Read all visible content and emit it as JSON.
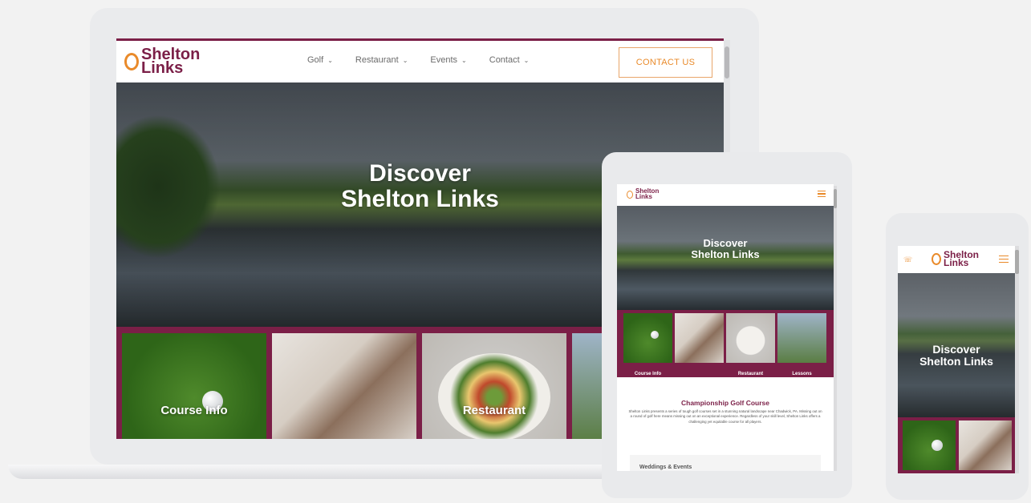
{
  "brand": {
    "logo_line1": "Shelton",
    "logo_line2": "Links",
    "primary_color": "#7b1f47",
    "accent_color": "#e98a2a"
  },
  "desktop": {
    "nav": {
      "items": [
        {
          "label": "Golf",
          "icon": "chevron-down-icon"
        },
        {
          "label": "Restaurant",
          "icon": "chevron-down-icon"
        },
        {
          "label": "Events",
          "icon": "chevron-down-icon"
        },
        {
          "label": "Contact",
          "icon": "chevron-down-icon"
        }
      ],
      "cta_label": "CONTACT US"
    },
    "hero": {
      "line1": "Discover",
      "line2": "Shelton Links"
    },
    "tiles": [
      {
        "label": "Course Info"
      },
      {
        "label": ""
      },
      {
        "label": "Restaurant"
      },
      {
        "label": ""
      }
    ]
  },
  "tablet": {
    "hero": {
      "line1": "Discover",
      "line2": "Shelton Links"
    },
    "tiles": [
      {
        "label": "Course Info"
      },
      {
        "label": ""
      },
      {
        "label": "Restaurant"
      },
      {
        "label": "Lessons"
      }
    ],
    "section": {
      "title": "Championship Golf Course",
      "body": "Shelton Links presents a series of tough golf courses set in a stunning natural landscape near Chadwick, PA. Missing out on a round of golf here means missing out on an exceptional experience. Regardless of your skill level, Shelton Links offers a challenging yet equitable course for all players."
    },
    "card_title": "Weddings & Events"
  },
  "phone": {
    "hero": {
      "line1": "Discover",
      "line2": "Shelton Links"
    }
  }
}
